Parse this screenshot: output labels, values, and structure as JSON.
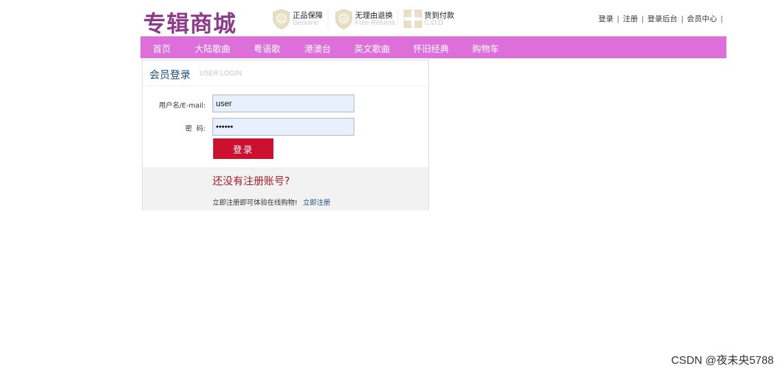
{
  "header": {
    "logo": "专辑商城",
    "badges": [
      {
        "title": "正品保障",
        "subtitle": "Genuine"
      },
      {
        "title": "无理由退换",
        "subtitle": "Free Returns"
      },
      {
        "title": "货到付款",
        "subtitle": "C.O.D"
      }
    ],
    "toplinks": [
      "登录",
      "注册",
      "登录后台",
      "会员中心"
    ],
    "trailing_pipe": "|"
  },
  "nav": {
    "items": [
      "首页",
      "大陆歌曲",
      "粤语歌",
      "港澳台",
      "英文歌曲",
      "怀旧经典",
      "购物车"
    ]
  },
  "login": {
    "title": "会员登录",
    "subtitle": "USER LOGIN",
    "username_label": "用户名/E-mail:",
    "username_value": "user",
    "password_label": "密  码:",
    "password_value": "••••••",
    "submit_label": "登录"
  },
  "register": {
    "question": "还没有注册账号?",
    "tip": "立即注册即可体验在线购物!",
    "link": "立即注册"
  },
  "watermark": "CSDN @夜未央5788",
  "colors": {
    "logo": "#8e3a8a",
    "nav_bg": "#dd6fda",
    "login_button": "#cc1030",
    "title_blue": "#1f4d86",
    "register_question": "#a9192a",
    "input_bg": "#e8f0fe"
  }
}
